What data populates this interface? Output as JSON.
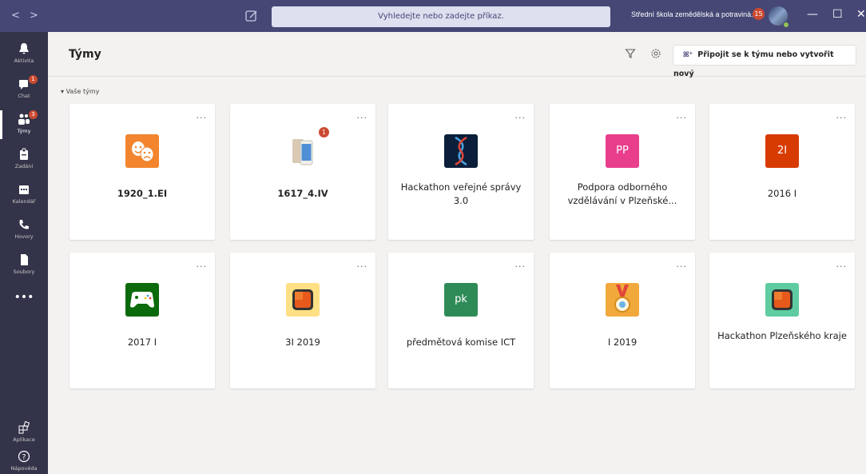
{
  "titlebar": {
    "search_placeholder": "Vyhledejte nebo zadejte příkaz.",
    "org_name": "Střední škola zemědělská a potravinà...",
    "org_badge": "15",
    "minimize": "—",
    "maximize": "☐",
    "close": "✕"
  },
  "rail": {
    "items": [
      {
        "label": "Aktivita",
        "icon": "bell-icon",
        "badge": ""
      },
      {
        "label": "Chat",
        "icon": "chat-icon",
        "badge": "1"
      },
      {
        "label": "Týmy",
        "icon": "teams-icon",
        "badge": "3"
      },
      {
        "label": "Zadání",
        "icon": "assignments-icon",
        "badge": ""
      },
      {
        "label": "Kalendář",
        "icon": "calendar-icon",
        "badge": ""
      },
      {
        "label": "Hovory",
        "icon": "phone-icon",
        "badge": ""
      },
      {
        "label": "Soubory",
        "icon": "files-icon",
        "badge": ""
      }
    ],
    "more": "•••",
    "apps": "Aplikace",
    "help": "Nápověda"
  },
  "header": {
    "title": "Týmy",
    "join_button": "Připojit se k týmu nebo vytvořit nový"
  },
  "section": "Vaše týmy",
  "teams": [
    {
      "name": "1920_1.EI",
      "logo": "theater-masks",
      "color": "#f2852d",
      "bold": true
    },
    {
      "name": "1617_4.IV",
      "logo": "phone-image",
      "color": "#ffffff",
      "bold": true,
      "badge": "1"
    },
    {
      "name": "Hackathon veřejné správy 3.0",
      "logo": "dna-image",
      "color": "#0b1f3a",
      "bold": false
    },
    {
      "name": "Podpora odborného vzdělávání v Plzeňské...",
      "logo_text": "PP",
      "color": "#e83e8c",
      "bold": false
    },
    {
      "name": "2016 I",
      "logo_text": "2I",
      "color": "#d83b01",
      "bold": false
    },
    {
      "name": "2017 I",
      "logo": "gamepad",
      "color": "#0b6a0b",
      "bold": false
    },
    {
      "name": "3I 2019",
      "logo": "office-square",
      "color": "#ffe084",
      "bold": false
    },
    {
      "name": "předmětová komise ICT",
      "logo_text": "pk",
      "color": "#2e8b57",
      "bold": false
    },
    {
      "name": "I 2019",
      "logo": "medal",
      "color": "#f2a93b",
      "bold": false
    },
    {
      "name": "Hackathon Plzeňského kraje",
      "logo": "office-square",
      "color": "#5ecca0",
      "bold": false
    }
  ],
  "card_more": "..."
}
